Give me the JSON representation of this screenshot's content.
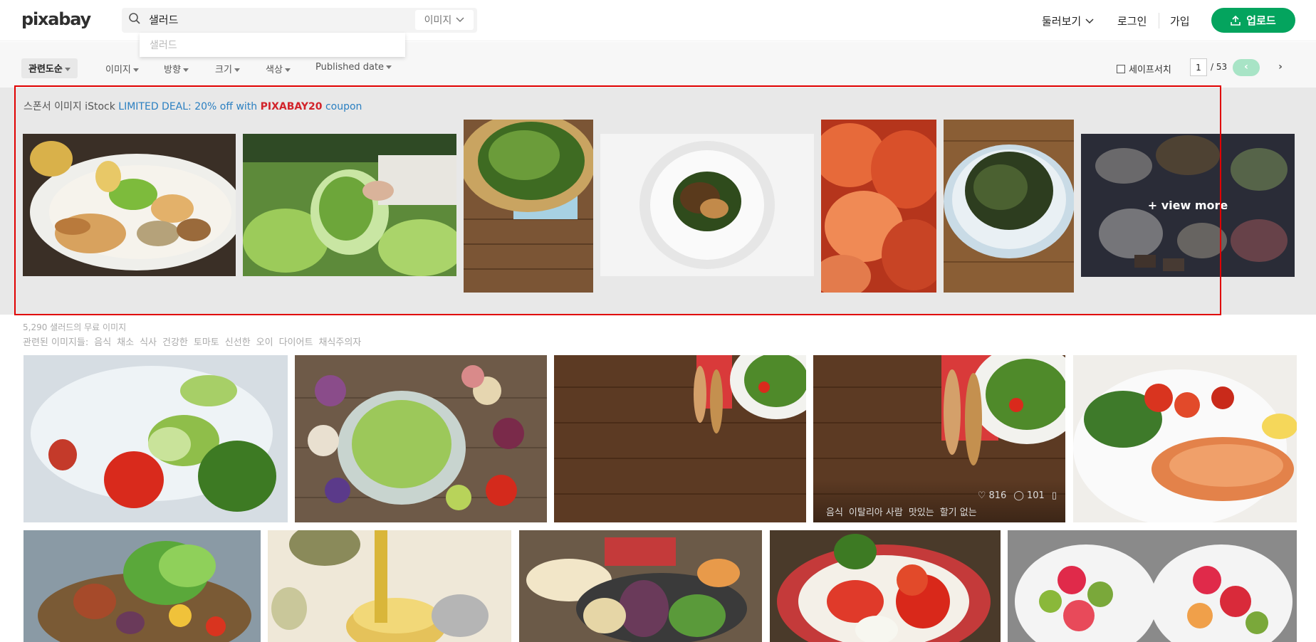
{
  "header": {
    "logo": "pixabay",
    "search": {
      "value": "샐러드",
      "placeholder": "",
      "type_label": "이미지"
    },
    "suggestion": "샐러드",
    "explore_label": "둘러보기",
    "login_label": "로그인",
    "signup_label": "가입",
    "upload_label": "업로드",
    "colors": {
      "upload": "#04a45e"
    }
  },
  "filters": {
    "relevance": "관련도순",
    "image_type": "이미지",
    "orientation": "방향",
    "size": "크기",
    "color": "색상",
    "published": "Published date",
    "safe_search": "세이프서치",
    "page": "1",
    "page_total": "/ 53",
    "prev_icon": "chevron-left-icon",
    "next_icon": "chevron-right-icon"
  },
  "sponsored": {
    "prefix": "스폰서 이미지 iStock",
    "deal": "LIMITED DEAL: 20% off with",
    "code": "PIXABAY20",
    "suffix": "coupon",
    "view_more": "+ view more",
    "images": [
      "chicken-pear-salad-bowl",
      "lettuce-bag-in-hand",
      "wild-greens-basket-wood",
      "seasoned-greens-white-plate",
      "kimchi-closeup",
      "greens-plate-on-wood",
      "korean-side-dishes"
    ]
  },
  "results": {
    "count_text": "5,290 샐러드의 무료 이미지",
    "related_label": "관련된 이미지들:",
    "related_tags": [
      "음식",
      "채소",
      "식사",
      "건강한",
      "토마토",
      "신선한",
      "오이",
      "다이어트",
      "채식주의자"
    ]
  },
  "hover_tile": {
    "likes": "816",
    "comments": "101",
    "tags": [
      "음식",
      "이탈리아 사람",
      "맛있는",
      "할기 없는"
    ]
  }
}
